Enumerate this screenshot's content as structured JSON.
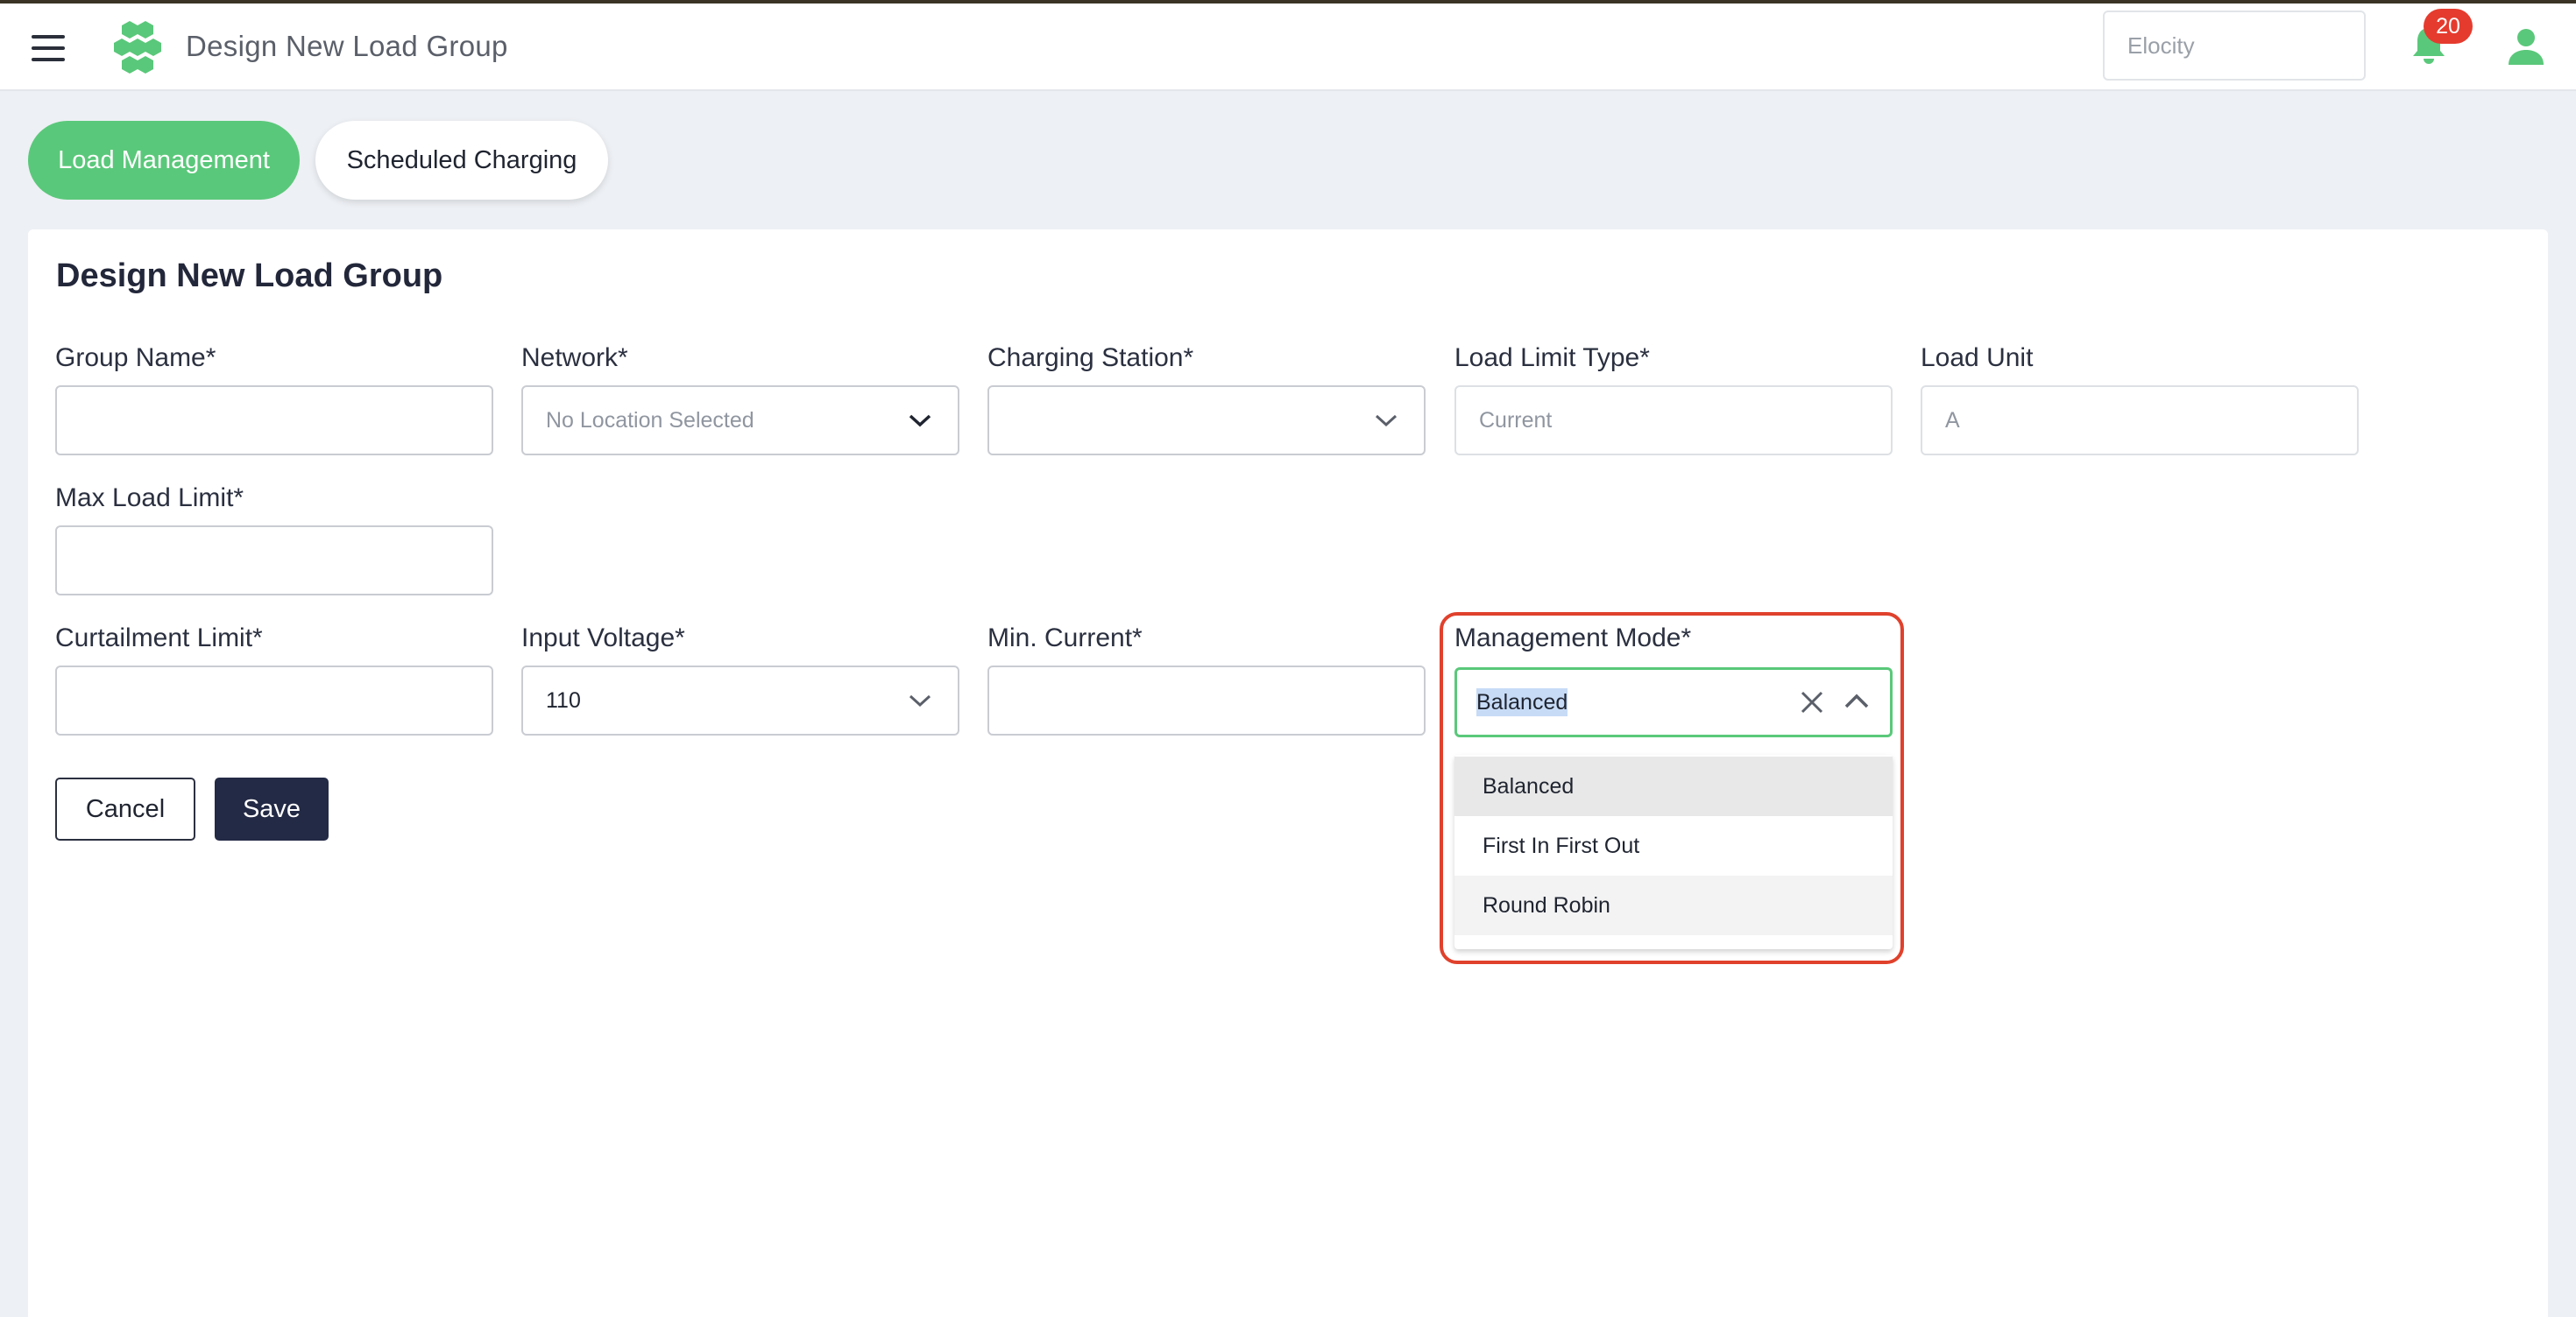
{
  "header": {
    "app_title": "Design New Load Group",
    "search_placeholder": "Elocity",
    "notification_count": "20"
  },
  "tabs": [
    {
      "label": "Load Management",
      "active": true
    },
    {
      "label": "Scheduled Charging",
      "active": false
    }
  ],
  "form": {
    "title": "Design New Load Group",
    "group_name": {
      "label": "Group Name*",
      "value": ""
    },
    "network": {
      "label": "Network*",
      "value": "No Location Selected"
    },
    "charging_station": {
      "label": "Charging Station*",
      "value": ""
    },
    "load_limit_type": {
      "label": "Load Limit Type*",
      "value": "Current"
    },
    "load_unit": {
      "label": "Load Unit",
      "value": "A"
    },
    "max_load_limit": {
      "label": "Max Load Limit*",
      "value": ""
    },
    "curtailment_limit": {
      "label": "Curtailment Limit*",
      "value": ""
    },
    "input_voltage": {
      "label": "Input Voltage*",
      "value": "110"
    },
    "min_current": {
      "label": "Min. Current*",
      "value": ""
    },
    "management_mode": {
      "label": "Management Mode*",
      "value": "Balanced",
      "options": [
        "Balanced",
        "First In First Out",
        "Round Robin"
      ]
    },
    "cancel_label": "Cancel",
    "save_label": "Save"
  },
  "colors": {
    "accent_green": "#5ac87a",
    "save_button": "#232a45",
    "badge_red": "#e53b2e",
    "annotation_red": "#e0412c"
  }
}
